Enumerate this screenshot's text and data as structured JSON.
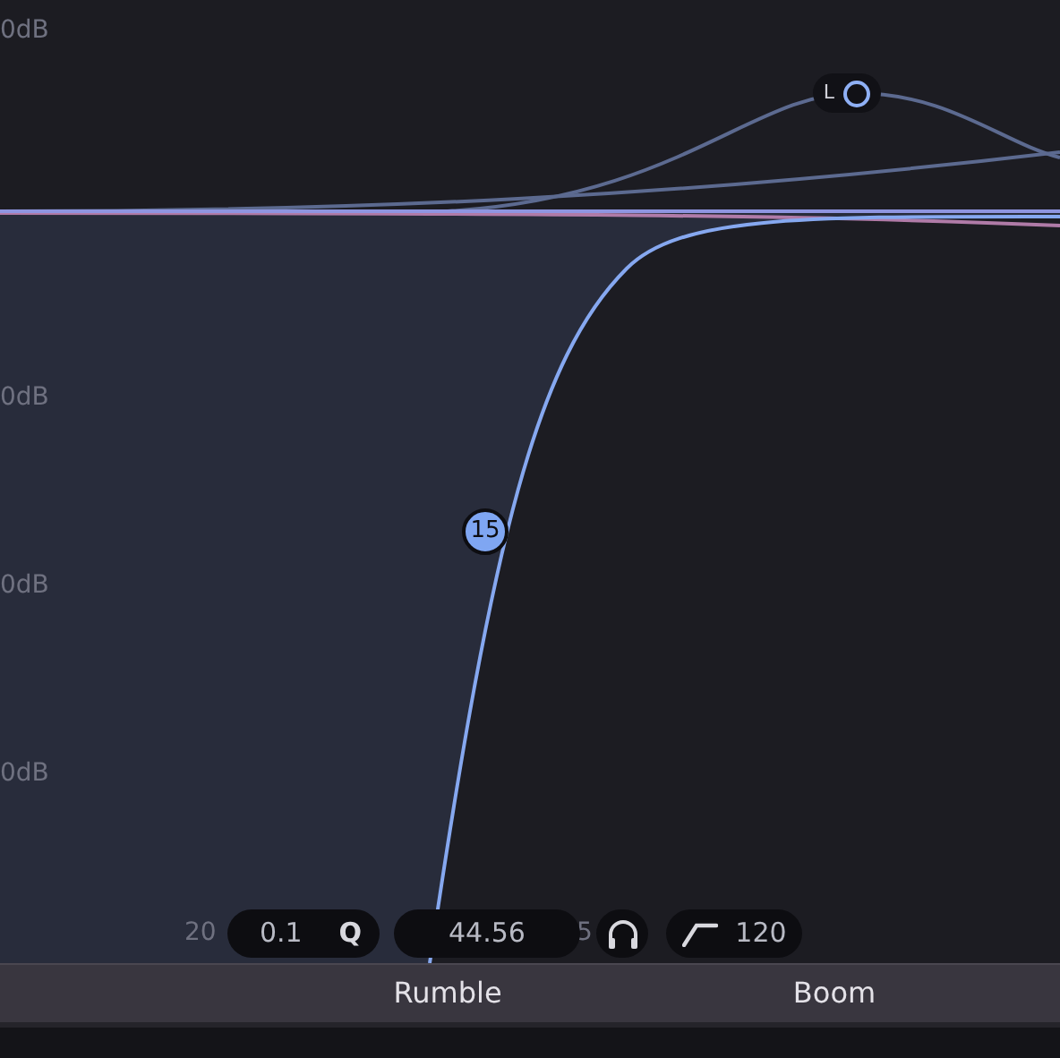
{
  "gain_labels": [
    "0dB",
    "0dB",
    "0dB",
    "0dB"
  ],
  "freq_labels": [
    "20",
    "5"
  ],
  "nodes": [
    {
      "label": "15",
      "kind": "filled"
    },
    {
      "label": "L",
      "kind": "ring"
    }
  ],
  "controls": {
    "q": "0.1",
    "q_label": "Q",
    "frequency": "44.56",
    "slope": "120"
  },
  "band_names": [
    "Rumble",
    "Boom"
  ]
}
